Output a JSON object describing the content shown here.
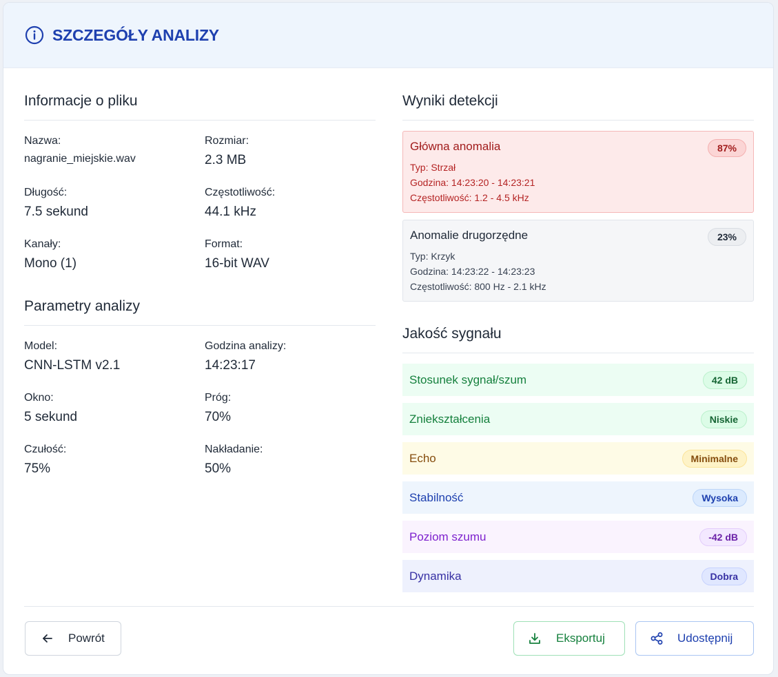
{
  "header": {
    "title": "SZCZEGÓŁY ANALIZY",
    "icon": "info-icon"
  },
  "file_info": {
    "title": "Informacje o pliku",
    "fields": [
      {
        "label": "Nazwa:",
        "value": "nagranie_miejskie.wav"
      },
      {
        "label": "Rozmiar:",
        "value": "2.3 MB"
      },
      {
        "label": "Długość:",
        "value": "7.5 sekund"
      },
      {
        "label": "Częstotliwość:",
        "value": "44.1 kHz"
      },
      {
        "label": "Kanały:",
        "value": "Mono (1)"
      },
      {
        "label": "Format:",
        "value": "16-bit WAV"
      }
    ]
  },
  "analysis_params": {
    "title": "Parametry analizy",
    "fields": [
      {
        "label": "Model:",
        "value": "CNN-LSTM v2.1"
      },
      {
        "label": "Godzina analizy:",
        "value": "14:23:17"
      },
      {
        "label": "Okno:",
        "value": "5 sekund"
      },
      {
        "label": "Próg:",
        "value": "70%"
      },
      {
        "label": "Czułość:",
        "value": "75%"
      },
      {
        "label": "Nakładanie:",
        "value": "50%"
      }
    ]
  },
  "detection": {
    "title": "Wyniki detekcji",
    "items": [
      {
        "title": "Główna anomalia",
        "score": "87%",
        "type": "Typ: Strzał",
        "time": "Godzina: 14:23:20 - 14:23:21",
        "freq": "Częstotliwość: 1.2 - 4.5 kHz"
      },
      {
        "title": "Anomalie drugorzędne",
        "score": "23%",
        "type": "Typ: Krzyk",
        "time": "Godzina: 14:23:22 - 14:23:23",
        "freq": "Częstotliwość: 800 Hz - 2.1 kHz"
      }
    ]
  },
  "signal_quality": {
    "title": "Jakość sygnału",
    "rows": [
      {
        "label": "Stosunek sygnał/szum",
        "value": "42 dB",
        "color": "#15803d"
      },
      {
        "label": "Zniekształcenia",
        "value": "Niskie",
        "color": "#15803d"
      },
      {
        "label": "Echo",
        "value": "Minimalne",
        "color": "#854d0e"
      },
      {
        "label": "Stabilność",
        "value": "Wysoka",
        "color": "#1e40af"
      },
      {
        "label": "Poziom szumu",
        "value": "-42 dB",
        "color": "#7e22ce"
      },
      {
        "label": "Dynamika",
        "value": "Dobra",
        "color": "#3730a3"
      }
    ]
  },
  "footer": {
    "back_label": "Powrót",
    "export_label": "Eksportuj",
    "share_label": "Udostępnij"
  }
}
